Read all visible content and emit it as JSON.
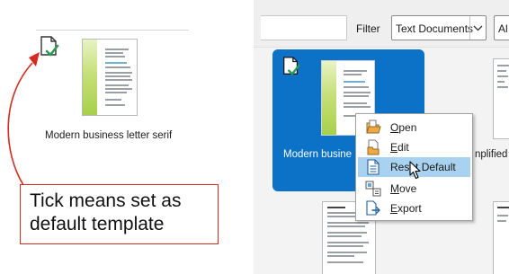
{
  "left_panel": {
    "template_caption": "Modern business letter serif",
    "annotation_line1": "Tick means set as",
    "annotation_line2": "default template",
    "annotation_color": "#d52b1e",
    "default_icon": "document-check-icon"
  },
  "right_panel": {
    "filter_label": "Filter",
    "filter_value": "Text Documents",
    "category_value": "Al",
    "selected_tile_caption": "Modern busine",
    "neighbor_caption_fragment": "nplified",
    "selection_color": "#0b72c8"
  },
  "context_menu": {
    "items": [
      {
        "first": "O",
        "rest": "pen",
        "icon": "open-icon"
      },
      {
        "first": "E",
        "rest": "dit",
        "icon": "edit-icon"
      },
      {
        "first": "Res",
        "mid": "e",
        "rest": "t Default",
        "icon": "reset-default-icon"
      },
      {
        "first": "M",
        "rest": "ove",
        "icon": "move-icon"
      },
      {
        "first": "E",
        "rest": "xport",
        "icon": "export-icon"
      }
    ],
    "hover_color": "#a9d2f0"
  }
}
